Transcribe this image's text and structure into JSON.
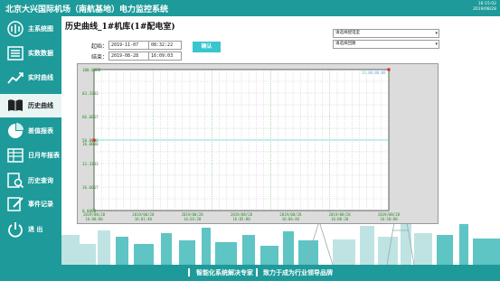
{
  "header": {
    "title": "北京大兴国际机场（南航基地）电力监控系统",
    "time": "16:15:02",
    "date": "2019/08/28"
  },
  "sidebar": {
    "items": [
      {
        "label": "主系统图",
        "icon": "switch-icon",
        "active": false
      },
      {
        "label": "实数数据",
        "icon": "list-icon",
        "active": false
      },
      {
        "label": "实时曲线",
        "icon": "trend-icon",
        "active": false
      },
      {
        "label": "历史曲线",
        "icon": "book-icon",
        "active": true
      },
      {
        "label": "差值报表",
        "icon": "pie-icon",
        "active": false
      },
      {
        "label": "日月年报表",
        "icon": "table-icon",
        "active": false
      },
      {
        "label": "历史查询",
        "icon": "search-doc-icon",
        "active": false
      },
      {
        "label": "事件记录",
        "icon": "edit-icon",
        "active": false
      },
      {
        "label": "退 出",
        "icon": "power-icon",
        "active": false
      }
    ]
  },
  "main": {
    "title": "历史曲线_1#机库(1#配电室)",
    "start_label": "起始：",
    "start_date": "2019-11-07",
    "start_time": "08:32:22",
    "end_label": "结束：",
    "end_date": "2019-08-28",
    "end_time": "16:09:03",
    "confirm_label": "确认",
    "select1": "请选择配电室",
    "select2": "请选择回路"
  },
  "footer": {
    "left": "智能化系统解决专家",
    "right": "致力于成为行业领导品牌"
  },
  "colors": {
    "teal": "#1e9a9a",
    "accent": "#39c6cf"
  },
  "chart_data": {
    "type": "line",
    "y_ticks": [
      "100.0000",
      "83.3333",
      "66.6667",
      "50.0000",
      "33.3333",
      "16.6667",
      "0.0000"
    ],
    "extra_ticks": [
      "50.0000",
      "16.0000"
    ],
    "legend": "11:00:00:00",
    "x_ticks": [
      {
        "date": "2019/08/28",
        "time": "16:00:00"
      },
      {
        "date": "2019/08/28",
        "time": "16:01:40"
      },
      {
        "date": "2019/08/28",
        "time": "16:03:20"
      },
      {
        "date": "2019/08/28",
        "time": "16:05:00"
      },
      {
        "date": "2019/08/28",
        "time": "16:06:40"
      },
      {
        "date": "2019/08/28",
        "time": "16:08:20"
      },
      {
        "date": "2019/08/28",
        "time": "16:10:00"
      }
    ],
    "ylim": [
      0,
      100
    ]
  }
}
